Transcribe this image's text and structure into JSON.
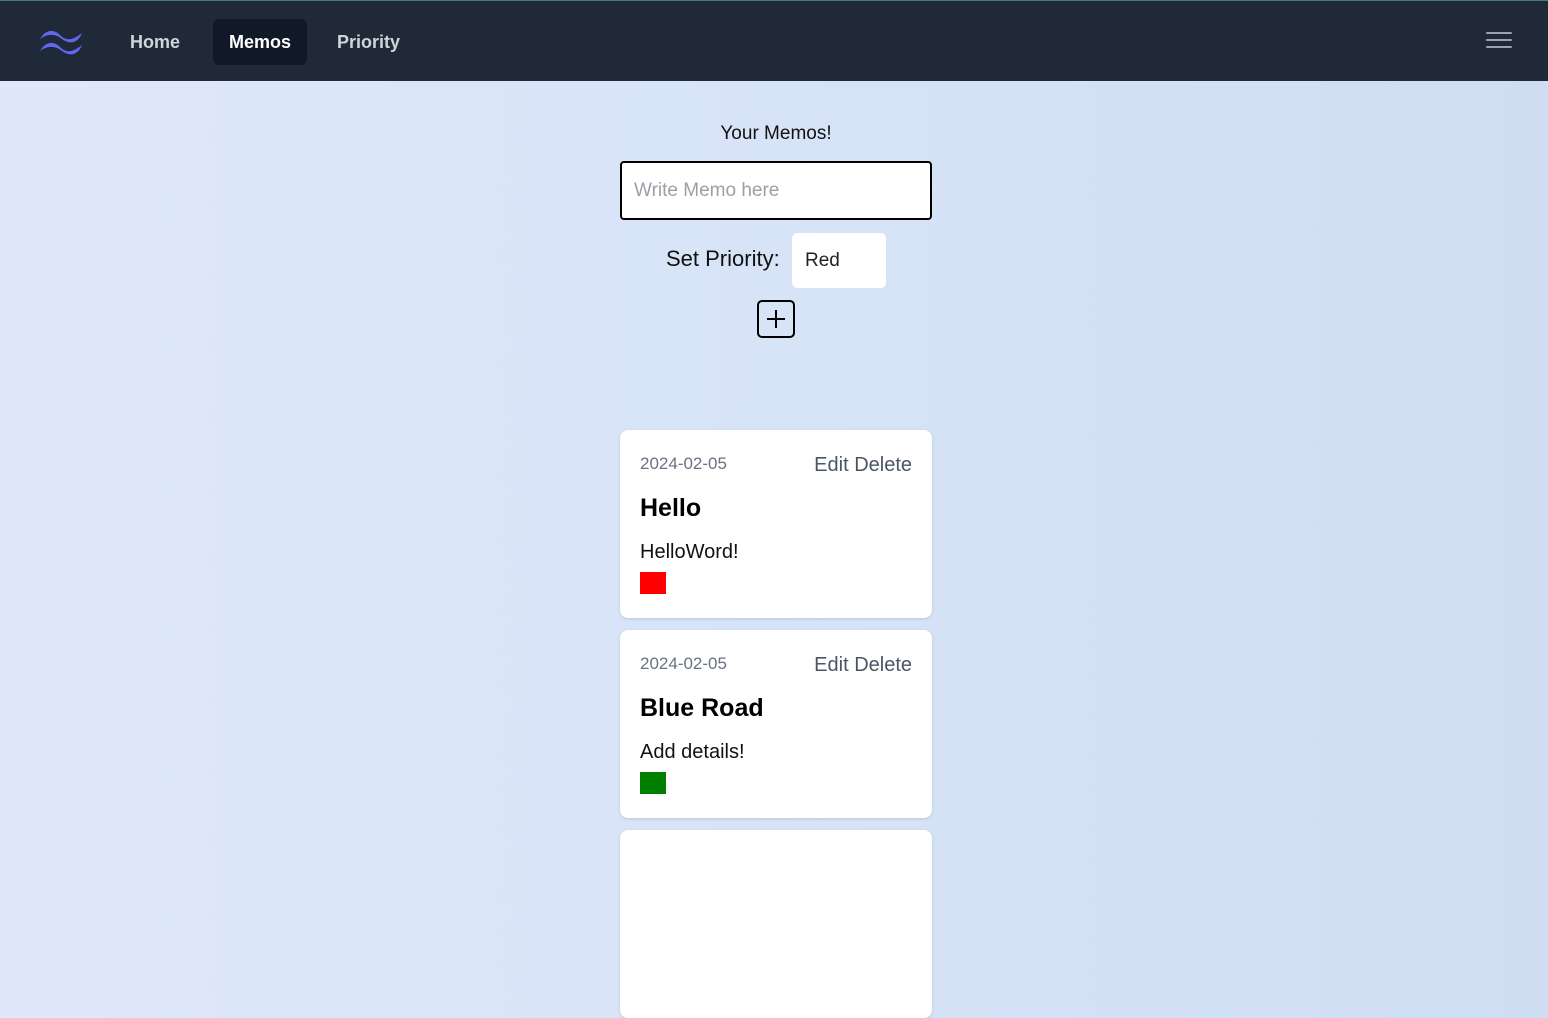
{
  "nav": {
    "items": [
      {
        "label": "Home",
        "active": false
      },
      {
        "label": "Memos",
        "active": true
      },
      {
        "label": "Priority",
        "active": false
      }
    ],
    "logo_icon": "tailwind-logo-icon",
    "menu_icon": "hamburger-menu-icon",
    "colors": {
      "bar": "#1f2937",
      "logo": "#6366f1"
    }
  },
  "form": {
    "heading": "Your Memos!",
    "memo_placeholder": "Write Memo here",
    "memo_value": "",
    "priority_label": "Set Priority:",
    "priority_value": "Red",
    "add_icon": "plus-square-icon"
  },
  "memos": [
    {
      "date": "2024-02-05",
      "edit": "Edit",
      "delete": "Delete",
      "title": "Hello",
      "body": "HelloWord!",
      "priority_color": "#ff0000"
    },
    {
      "date": "2024-02-05",
      "edit": "Edit",
      "delete": "Delete",
      "title": "Blue Road",
      "body": "Add details!",
      "priority_color": "#008000"
    }
  ]
}
